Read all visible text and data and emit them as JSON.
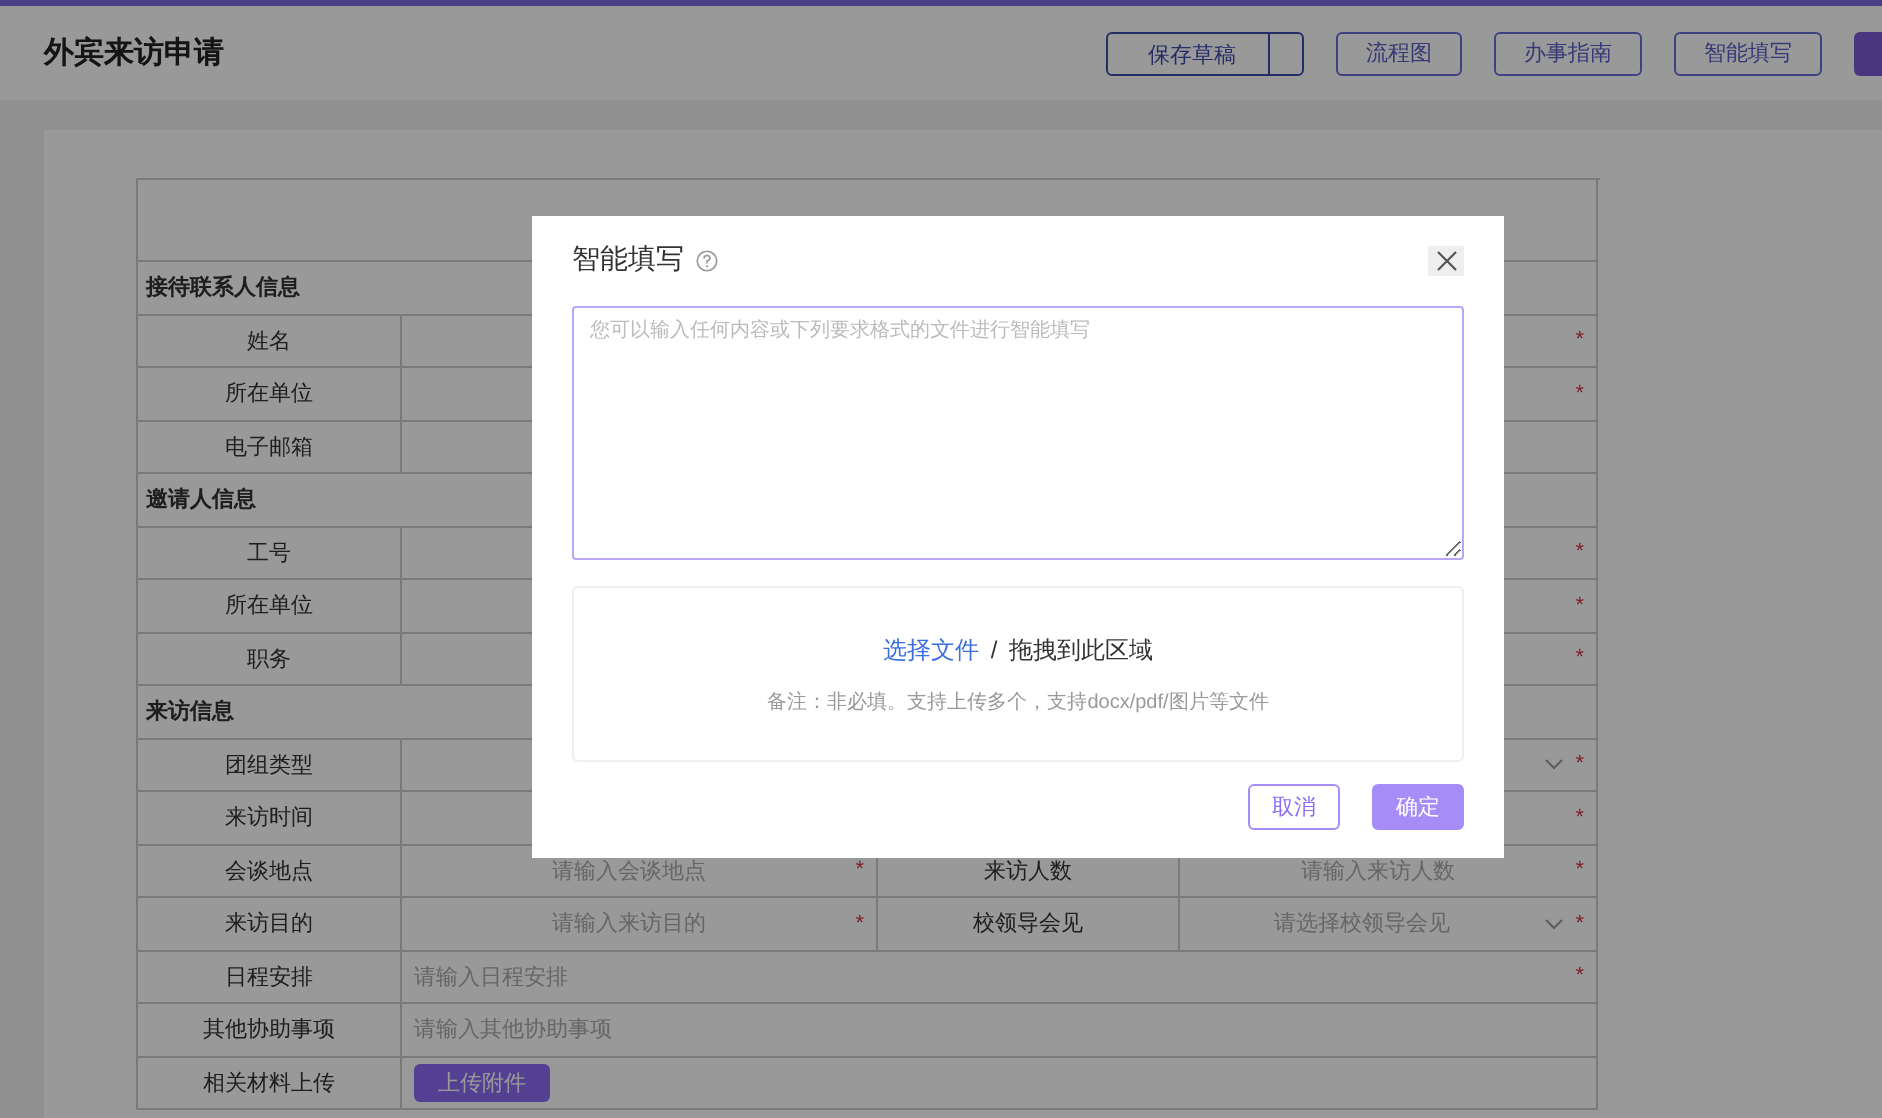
{
  "header": {
    "title": "外宾来访申请",
    "buttons": [
      {
        "label": "保存草稿",
        "kind": "split"
      },
      {
        "label": "流程图",
        "kind": "outline"
      },
      {
        "label": "办事指南",
        "kind": "outline"
      },
      {
        "label": "智能填写",
        "kind": "outline"
      },
      {
        "kind": "primary"
      }
    ]
  },
  "form": {
    "sections": [
      {
        "heading": "接待联系人信息",
        "rows": [
          {
            "kind": "field",
            "label": "姓名",
            "required_mark": "*"
          },
          {
            "kind": "field",
            "label": "所在单位",
            "required_mark": "*"
          },
          {
            "kind": "field",
            "label": "电子邮箱"
          }
        ]
      },
      {
        "heading": "邀请人信息",
        "rows": [
          {
            "kind": "field",
            "label": "工号",
            "required_mark": "*"
          },
          {
            "kind": "field",
            "label": "所在单位",
            "required_mark": "*"
          },
          {
            "kind": "field",
            "label": "职务",
            "required_mark": "*"
          }
        ]
      },
      {
        "heading": "来访信息",
        "rows": [
          {
            "kind": "select",
            "label": "团组类型",
            "required_mark": "*"
          },
          {
            "kind": "field",
            "label": "来访时间",
            "required_mark": "*"
          },
          {
            "kind": "pair",
            "fields": [
              {
                "kind": "field",
                "label": "会谈地点",
                "placeholder": "请输入会谈地点",
                "required_mark": "*"
              },
              {
                "kind": "field",
                "label": "来访人数",
                "placeholder": "请输入来访人数",
                "required_mark": "*"
              }
            ]
          },
          {
            "kind": "pair",
            "fields": [
              {
                "kind": "field",
                "label": "来访目的",
                "placeholder": "请输入来访目的",
                "required_mark": "*"
              },
              {
                "kind": "select",
                "label": "校领导会见",
                "placeholder": "请选择校领导会见",
                "required_mark": "*"
              }
            ]
          },
          {
            "kind": "field",
            "label": "日程安排",
            "placeholder": "请输入日程安排",
            "required_mark": "*"
          },
          {
            "kind": "field",
            "label": "其他协助事项",
            "placeholder": "请输入其他协助事项"
          },
          {
            "kind": "upload",
            "label": "相关材料上传",
            "button": "上传附件"
          }
        ]
      }
    ]
  },
  "modal": {
    "title": "智能填写",
    "text_input": {
      "placeholder": "您可以输入任何内容或下列要求格式的文件进行智能填写"
    },
    "upload": {
      "link": "选择文件",
      "separator": "/",
      "text": "拖拽到此区域",
      "note": "备注：非必填。支持上传多个，支持docx/pdf/图片等文件"
    },
    "buttons": [
      {
        "label": "取消",
        "kind": "secondary"
      },
      {
        "label": "确定",
        "kind": "primary"
      }
    ]
  }
}
